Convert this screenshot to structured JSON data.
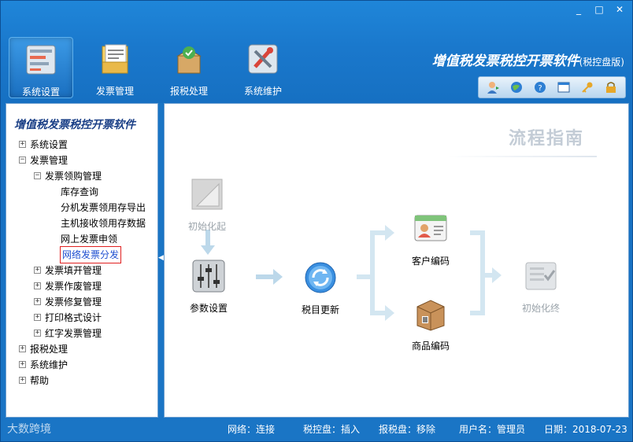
{
  "window": {
    "minimize": "_",
    "maximize": "□",
    "close": "✕"
  },
  "toolbar": {
    "items": [
      {
        "label": "系统设置",
        "icon": "settings-panel-icon"
      },
      {
        "label": "发票管理",
        "icon": "invoice-folder-icon"
      },
      {
        "label": "报税处理",
        "icon": "tax-filing-icon"
      },
      {
        "label": "系统维护",
        "icon": "maintenance-tools-icon"
      }
    ]
  },
  "brand": {
    "title": "增值税发票税控开票软件",
    "subtitle": "(税控盘版)"
  },
  "mini_toolbar": [
    "user-switch-icon",
    "globe-icon",
    "help-icon",
    "window-icon",
    "key-icon",
    "lock-icon"
  ],
  "sidebar": {
    "title": "增值税发票税控开票软件",
    "tree": [
      {
        "label": "系统设置",
        "expander": "+"
      },
      {
        "label": "发票管理",
        "expander": "−"
      },
      {
        "label": "发票领购管理",
        "expander": "−"
      },
      {
        "label": "库存查询"
      },
      {
        "label": "分机发票领用存导出"
      },
      {
        "label": "主机接收领用存数据"
      },
      {
        "label": "网上发票申领"
      },
      {
        "label": "网络发票分发"
      },
      {
        "label": "发票填开管理",
        "expander": "+"
      },
      {
        "label": "发票作废管理",
        "expander": "+"
      },
      {
        "label": "发票修复管理",
        "expander": "+"
      },
      {
        "label": "打印格式设计",
        "expander": "+"
      },
      {
        "label": "红字发票管理",
        "expander": "+"
      },
      {
        "label": "报税处理",
        "expander": "+"
      },
      {
        "label": "系统维护",
        "expander": "+"
      },
      {
        "label": "帮助",
        "expander": "+"
      }
    ]
  },
  "flow": {
    "title": "流程指南",
    "nodes": {
      "init_start": "初始化起",
      "params": "参数设置",
      "tax_update": "税目更新",
      "customer_code": "客户编码",
      "product_code": "商品编码",
      "init_end": "初始化终"
    }
  },
  "status": {
    "logo": "大数跨境",
    "network": "网络：连接",
    "tax_disk": "税控盘：插入",
    "report_disk": "报税盘：移除",
    "user": "用户名：管理员",
    "date": "日期：2018-07-23"
  },
  "colors": {
    "accent": "#1a78cc",
    "brand_text": "#ffffff",
    "selected_outline": "#e02020"
  }
}
